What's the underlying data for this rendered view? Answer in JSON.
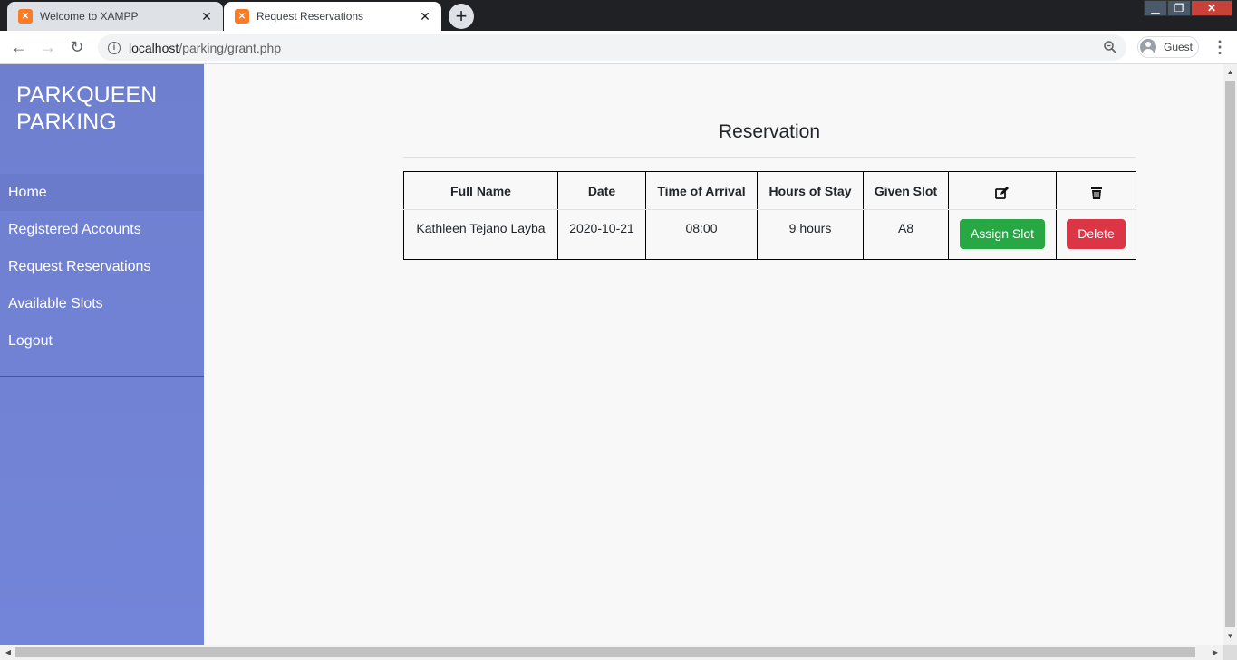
{
  "browser": {
    "tabs": [
      {
        "title": "Welcome to XAMPP",
        "active": false,
        "favicon": "xampp-icon"
      },
      {
        "title": "Request Reservations",
        "active": true,
        "favicon": "xampp-icon"
      }
    ],
    "url_host": "localhost",
    "url_path": "/parking/grant.php",
    "profile_label": "Guest"
  },
  "sidebar": {
    "brand_line1": "PARKQUEEN",
    "brand_line2": "PARKING",
    "items": [
      {
        "label": "Home"
      },
      {
        "label": "Registered Accounts"
      },
      {
        "label": "Request Reservations"
      },
      {
        "label": "Available Slots"
      },
      {
        "label": "Logout"
      }
    ]
  },
  "main": {
    "heading": "Reservation",
    "table": {
      "headers": [
        "Full Name",
        "Date",
        "Time of Arrival",
        "Hours of Stay",
        "Given Slot"
      ],
      "action_icons": [
        "edit-icon",
        "trash-icon"
      ],
      "rows": [
        {
          "full_name": "Kathleen Tejano Layba",
          "date": "2020-10-21",
          "time_of_arrival": "08:00",
          "hours_of_stay": "9 hours",
          "given_slot": "A8",
          "assign_label": "Assign Slot",
          "delete_label": "Delete"
        }
      ]
    }
  },
  "colors": {
    "sidebar": "#7384d6",
    "assign_button": "#28a745",
    "delete_button": "#dc3545",
    "favicon": "#fb7a24"
  }
}
